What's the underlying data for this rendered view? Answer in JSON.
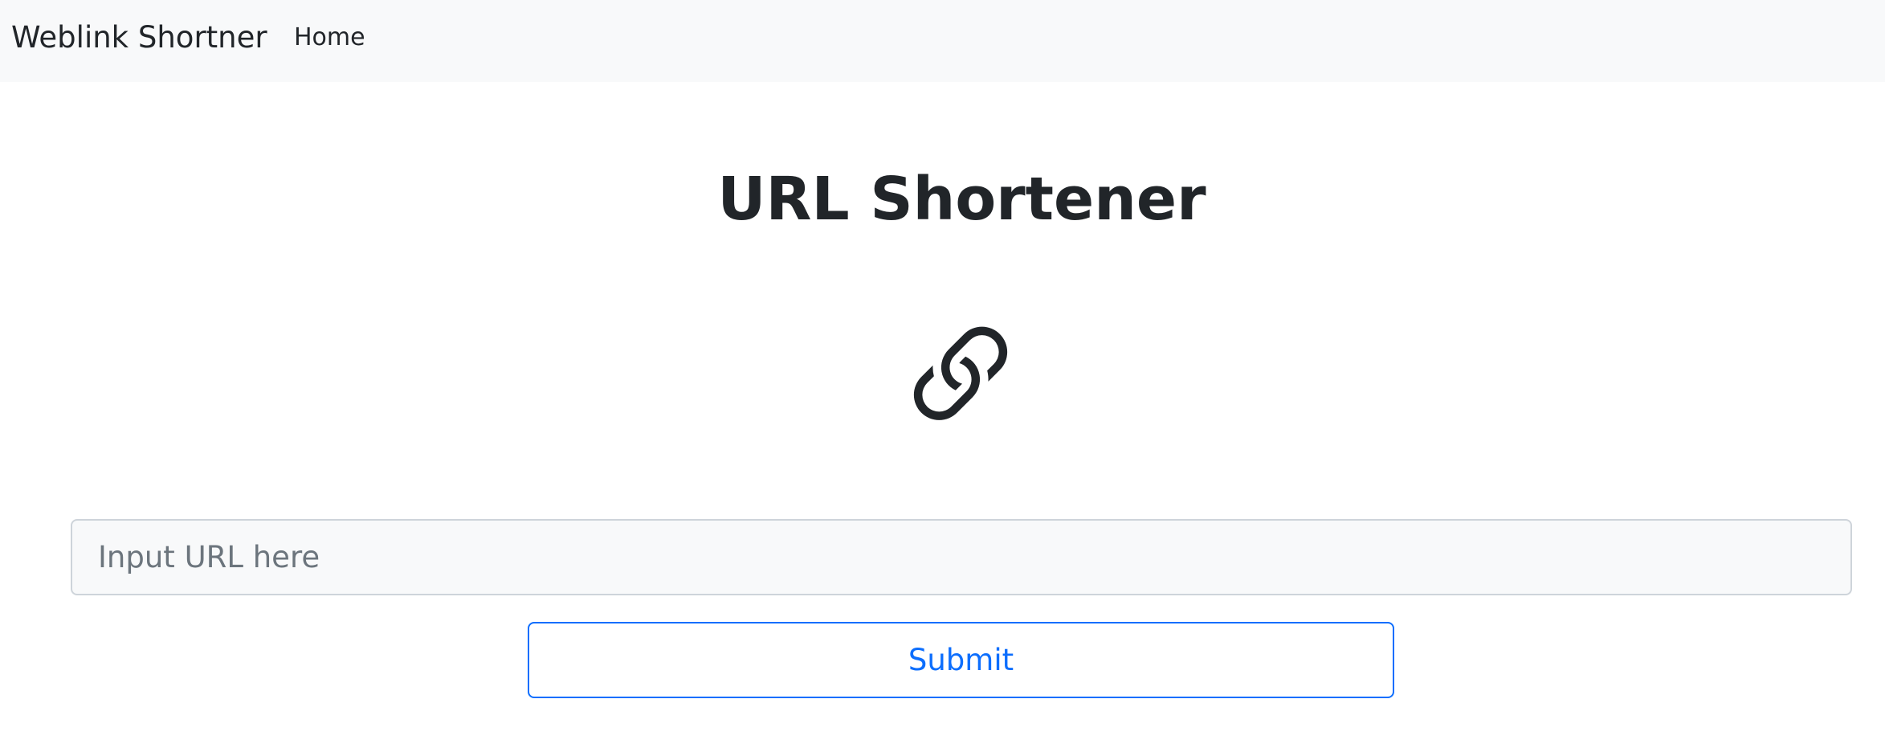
{
  "navbar": {
    "brand": "Weblink Shortner",
    "links": [
      {
        "label": "Home"
      }
    ]
  },
  "main": {
    "title": "URL Shortener",
    "icon": "link-icon",
    "input": {
      "placeholder": "Input URL here",
      "value": ""
    },
    "submit_label": "Submit"
  },
  "colors": {
    "navbar_bg": "#f8f9fa",
    "text": "#212529",
    "primary": "#0d6efd",
    "input_border": "#ced4da",
    "placeholder": "#6c757d"
  }
}
